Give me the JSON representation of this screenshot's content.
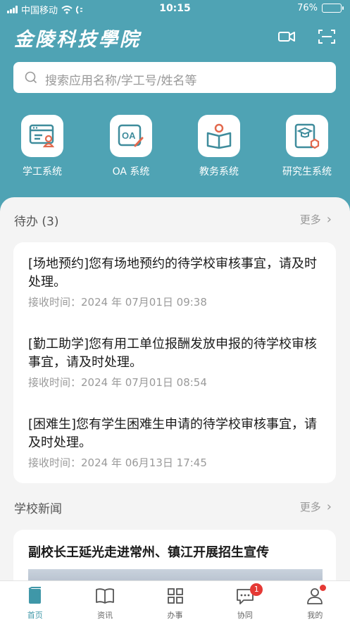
{
  "status_bar": {
    "carrier": "中国移动",
    "time": "10:15",
    "battery": "76%",
    "battery_level": 0.76
  },
  "header": {
    "brand": "金陵科技學院",
    "icons": [
      "video-camera-icon",
      "scan-icon"
    ]
  },
  "search": {
    "placeholder": "搜索应用名称/学工号/姓名等"
  },
  "quick_apps": [
    {
      "label": "学工系统",
      "icon": "student-affairs-icon"
    },
    {
      "label": "OA 系统",
      "icon": "oa-icon",
      "badge_text": "OA"
    },
    {
      "label": "教务系统",
      "icon": "academic-icon"
    },
    {
      "label": "研究生系统",
      "icon": "graduate-icon"
    }
  ],
  "todo": {
    "title": "待办 (3)",
    "more": "更多",
    "items": [
      {
        "title": "[场地预约]您有场地预约的待学校审核事宜，请及时处理。",
        "time": "接收时间：2024 年 07月01日 09:38"
      },
      {
        "title": "[勤工助学]您有用工单位报酬发放申报的待学校审核事宜，请及时处理。",
        "time": "接收时间：2024 年 07月01日 08:54"
      },
      {
        "title": "[困难生]您有学生困难生申请的待学校审核事宜，请及时处理。",
        "time": "接收时间：2024 年 06月13日 17:45"
      }
    ]
  },
  "news": {
    "title": "学校新闻",
    "more": "更多",
    "headline": "副校长王延光走进常州、镇江开展招生宣传"
  },
  "tabbar": [
    {
      "label": "首页",
      "icon": "home-icon",
      "active": true
    },
    {
      "label": "资讯",
      "icon": "book-icon"
    },
    {
      "label": "办事",
      "icon": "grid-icon"
    },
    {
      "label": "协同",
      "icon": "chat-icon",
      "badge": "1"
    },
    {
      "label": "我的",
      "icon": "profile-icon",
      "dot": true
    }
  ],
  "colors": {
    "accent": "#4fa3b4",
    "icon_stroke": "#3f8c9c",
    "icon_highlight": "#e2694d",
    "badge": "#e53935"
  }
}
